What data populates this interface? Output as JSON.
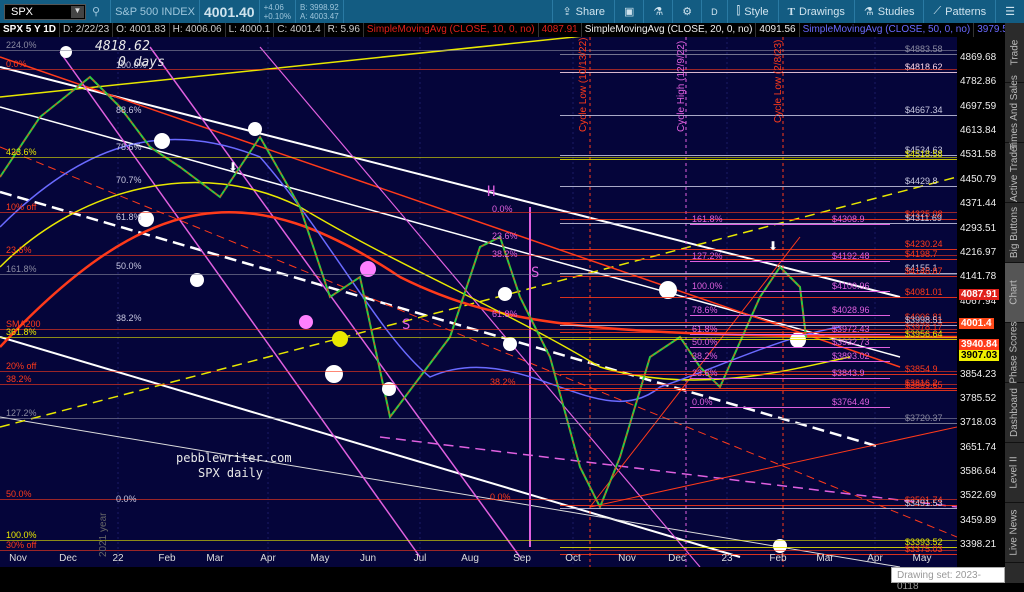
{
  "toolbar": {
    "symbol": "SPX",
    "name": "S&P 500 INDEX",
    "last": "4001.40",
    "change": "+4.06",
    "change_pct": "+0.10%",
    "bid": "B: 3998.92",
    "ask": "A: 4003.47",
    "share": "Share",
    "period": "D",
    "style": "Style",
    "drawings": "Drawings",
    "studies": "Studies",
    "patterns": "Patterns"
  },
  "infobar": {
    "title": "SPX 5 Y 1D",
    "date": "D: 2/22/23",
    "open": "O: 4001.83",
    "high": "H: 4006.06",
    "low": "L: 4000.1",
    "close": "C: 4001.4",
    "range": "R: 5.96",
    "sma10": "SimpleMovingAvg (CLOSE, 10, 0, no)",
    "sma10_val": "4087.91",
    "sma20": "SimpleMovingAvg (CLOSE, 20, 0, no)",
    "sma20_val": "4091.56",
    "sma50": "SimpleMovingAvg (CLOSE, 50, 0, no)",
    "sma50_val": "3979.54",
    "more": "..."
  },
  "axis": {
    "ticks": [
      "4869.68",
      "4782.86",
      "4697.59",
      "4613.84",
      "4531.58",
      "4450.79",
      "4371.44",
      "4293.51",
      "4216.97",
      "4141.78",
      "4067.94",
      "3854.23",
      "3785.52",
      "3718.03",
      "3651.74",
      "3586.64",
      "3522.69",
      "3459.89",
      "3398.21"
    ],
    "badges": [
      {
        "text": "4087.91",
        "price": 4087.91,
        "bg": "#e0201a",
        "fg": "#fff"
      },
      {
        "text": "4001.4",
        "price": 4001.4,
        "bg": "#ff4a1a",
        "fg": "#fff"
      },
      {
        "text": "3940.84",
        "price": 3940.84,
        "bg": "#ff3a1a",
        "fg": "#fff"
      },
      {
        "text": "3907.03",
        "price": 3907.03,
        "bg": "#f0f000",
        "fg": "#000"
      }
    ]
  },
  "levels": [
    {
      "text": "$4883.58",
      "price": 4883.58,
      "color": "#8a8aa0"
    },
    {
      "text": "$4818.62",
      "price": 4818.62,
      "color": "#ffd8e8"
    },
    {
      "text": "$4667.34",
      "price": 4667.34,
      "color": "#c8c8e0"
    },
    {
      "text": "$4534.63",
      "price": 4534.63,
      "color": "#c8c8e0"
    },
    {
      "text": "$4518.58",
      "price": 4518.58,
      "color": "#e8e800"
    },
    {
      "text": "$4429.8",
      "price": 4429.8,
      "color": "#c8c8e0"
    },
    {
      "text": "$4325.08",
      "price": 4325.08,
      "color": "#ff3a1a"
    },
    {
      "text": "$4311.69",
      "price": 4311.69,
      "color": "#c8c8e0"
    },
    {
      "text": "$4230.24",
      "price": 4230.24,
      "color": "#ff3a1a"
    },
    {
      "text": "$4198.7",
      "price": 4198.7,
      "color": "#ff3a1a"
    },
    {
      "text": "$4155.1",
      "price": 4155.1,
      "color": "#c8c8e0"
    },
    {
      "text": "$4146.87",
      "price": 4146.87,
      "color": "#ff3a1a"
    },
    {
      "text": "$4081.01",
      "price": 4081.01,
      "color": "#ff3a1a"
    },
    {
      "text": "$4006.81",
      "price": 4006.81,
      "color": "#ff3a1a"
    },
    {
      "text": "$3998.51",
      "price": 3998.51,
      "color": "#c8c8e0"
    },
    {
      "text": "$3978.17",
      "price": 3978.17,
      "color": "#ff3a1a"
    },
    {
      "text": "$3956.64",
      "price": 3956.64,
      "color": "#e8e800"
    },
    {
      "text": "$3854.9",
      "price": 3854.9,
      "color": "#ff3a1a"
    },
    {
      "text": "$3816.2",
      "price": 3816.2,
      "color": "#ff3a1a"
    },
    {
      "text": "$3809.65",
      "price": 3809.65,
      "color": "#ff3a1a"
    },
    {
      "text": "$3720.37",
      "price": 3720.37,
      "color": "#8a8aa0"
    },
    {
      "text": "$3501.74",
      "price": 3501.74,
      "color": "#ff3a1a"
    },
    {
      "text": "$3491.53",
      "price": 3491.53,
      "color": "#c8c8e0"
    },
    {
      "text": "$3393.52",
      "price": 3393.52,
      "color": "#e8e800"
    },
    {
      "text": "$3375.03",
      "price": 3375.03,
      "color": "#ff3a1a"
    }
  ],
  "fib_right": [
    {
      "pct": "161.8%",
      "text": "$4308.9",
      "price": 4308.9
    },
    {
      "pct": "127.2%",
      "text": "$4192.48",
      "price": 4192.48
    },
    {
      "pct": "100.0%",
      "text": "$4100.96",
      "price": 4100.96
    },
    {
      "pct": "78.6%",
      "text": "$4028.96",
      "price": 4028.96
    },
    {
      "pct": "61.8%",
      "text": "$3972.43",
      "price": 3972.43
    },
    {
      "pct": "50.0%",
      "text": "$3932.73",
      "price": 3932.73
    },
    {
      "pct": "38.2%",
      "text": "$3893.02",
      "price": 3893.02
    },
    {
      "pct": "23.6%",
      "text": "$3843.9",
      "price": 3843.9
    },
    {
      "pct": "0.0%",
      "text": "$3764.49",
      "price": 3764.49
    }
  ],
  "left_labels": [
    {
      "text": "224.0%",
      "color": "#8a8aa0"
    },
    {
      "text": "0.0%",
      "color": "#ff3a1a"
    },
    {
      "text": "423.6%",
      "color": "#e8e800"
    },
    {
      "text": "10% off",
      "color": "#ff3a1a"
    },
    {
      "text": "23.6%",
      "color": "#ff3a1a"
    },
    {
      "text": "161.8%",
      "color": "#8a8aa0"
    },
    {
      "text": "SMA200",
      "color": "#ff3a1a"
    },
    {
      "text": "361.8%",
      "color": "#e8e800"
    },
    {
      "text": "20% off",
      "color": "#ff3a1a"
    },
    {
      "text": "38.2%",
      "color": "#ff3a1a"
    },
    {
      "text": "127.2%",
      "color": "#8a8aa0"
    },
    {
      "text": "50.0%",
      "color": "#ff3a1a"
    },
    {
      "text": "100.0%",
      "color": "#e8e800"
    },
    {
      "text": "30% off",
      "color": "#ff3a1a"
    }
  ],
  "fib_left": [
    "100.0%",
    "88.6%",
    "78.6%",
    "70.7%",
    "61.8%",
    "50.0%",
    "38.2%",
    "0.0%"
  ],
  "fib_aug": [
    "0.0%",
    "23.6%",
    "38.2%",
    "61.8%",
    "38.2%",
    "0.0%"
  ],
  "annotations": {
    "peak_price": "4818.62",
    "peak_days": "0 days",
    "watermark1": "pebblewriter.com",
    "watermark2": "SPX daily",
    "h": "H",
    "s1": "S",
    "s2": "S",
    "year": "2021 year"
  },
  "cycles": [
    {
      "text": "Cycle Low (10/13/22)",
      "color": "#ff3a1a"
    },
    {
      "text": "Cycle High (12/9/22)",
      "color": "#e060e0"
    },
    {
      "text": "Cycle Low (2/8/23)",
      "color": "#ff3a1a"
    }
  ],
  "xaxis": [
    "Nov",
    "Dec",
    "22",
    "Feb",
    "Mar",
    "Apr",
    "May",
    "Jun",
    "Jul",
    "Aug",
    "Sep",
    "Oct",
    "Nov",
    "Dec",
    "23",
    "Feb",
    "Mar",
    "Apr",
    "May"
  ],
  "sidebar": [
    "Trade",
    "Times And Sales",
    "Active Trader",
    "Big Buttons",
    "Chart",
    "Phase Scores",
    "Dashboard",
    "Level II",
    "Live News"
  ],
  "drawing_set": "Drawing set: 2023-0118"
}
